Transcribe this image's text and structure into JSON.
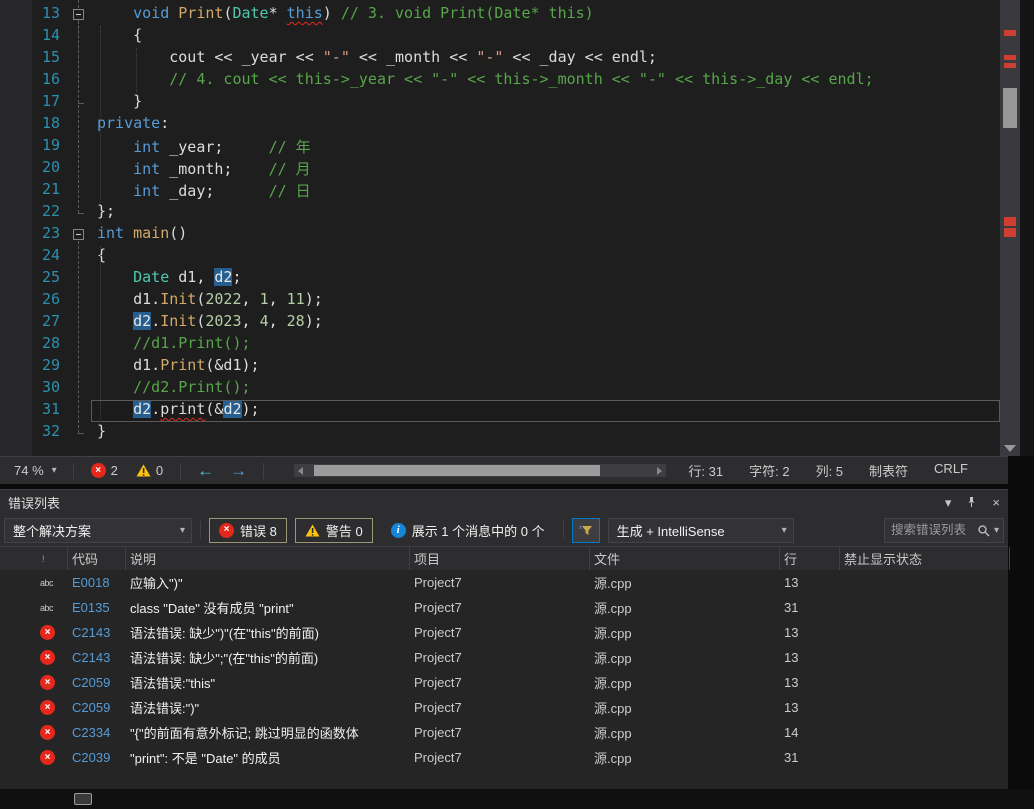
{
  "colors": {
    "accent": "#007ACC",
    "error_red": "#E5281C",
    "warning_yellow": "#FFC20E",
    "keyword": "#569CD6",
    "type": "#4EC9B0",
    "string": "#D69D85",
    "comment": "#57A64A",
    "number": "#B5CEA8",
    "function": "#D2A96A",
    "line_number": "#2B91AF",
    "reference_highlight": "#265F8F"
  },
  "editor": {
    "code_lines": [
      {
        "n": "13",
        "fold": true,
        "tok": [
          [
            "d",
            "    "
          ],
          [
            "kw",
            "void"
          ],
          [
            "d",
            " "
          ],
          [
            "fn",
            "Print"
          ],
          [
            "d",
            "("
          ],
          [
            "ty",
            "Date"
          ],
          [
            "d",
            "* "
          ],
          [
            "kw sq",
            "this"
          ],
          [
            "d",
            ") "
          ],
          [
            "cm",
            "// 3. void Print(Date* this)"
          ]
        ]
      },
      {
        "n": "14",
        "tok": [
          [
            "d",
            "    {"
          ]
        ]
      },
      {
        "n": "15",
        "tok": [
          [
            "d",
            "        cout << _year << "
          ],
          [
            "st",
            "\"-\""
          ],
          [
            "d",
            " << _month << "
          ],
          [
            "st",
            "\"-\""
          ],
          [
            "d",
            " << _day << endl;"
          ]
        ]
      },
      {
        "n": "16",
        "tok": [
          [
            "d",
            "        "
          ],
          [
            "cm",
            "// 4. cout << this->_year << \"-\" << this->_month << \"-\" << this->_day << endl;"
          ]
        ]
      },
      {
        "n": "17",
        "tok": [
          [
            "d",
            "    }"
          ]
        ]
      },
      {
        "n": "18",
        "tok": [
          [
            "kw",
            "private"
          ],
          [
            "d",
            ":"
          ]
        ]
      },
      {
        "n": "19",
        "tok": [
          [
            "d",
            "    "
          ],
          [
            "kw",
            "int"
          ],
          [
            "d",
            " _year;     "
          ],
          [
            "cm",
            "// 年"
          ]
        ]
      },
      {
        "n": "20",
        "tok": [
          [
            "d",
            "    "
          ],
          [
            "kw",
            "int"
          ],
          [
            "d",
            " _month;    "
          ],
          [
            "cm",
            "// 月"
          ]
        ]
      },
      {
        "n": "21",
        "tok": [
          [
            "d",
            "    "
          ],
          [
            "kw",
            "int"
          ],
          [
            "d",
            " _day;      "
          ],
          [
            "cm",
            "// 日"
          ]
        ]
      },
      {
        "n": "22",
        "tok": [
          [
            "d",
            "};"
          ]
        ]
      },
      {
        "n": "23",
        "fold": true,
        "tok": [
          [
            "kw",
            "int"
          ],
          [
            "d",
            " "
          ],
          [
            "fn",
            "main"
          ],
          [
            "d",
            "()"
          ]
        ]
      },
      {
        "n": "24",
        "tok": [
          [
            "d",
            "{"
          ]
        ]
      },
      {
        "n": "25",
        "tok": [
          [
            "d",
            "    "
          ],
          [
            "ty",
            "Date"
          ],
          [
            "d",
            " d1, "
          ],
          [
            "hl",
            "d2"
          ],
          [
            "d",
            ";"
          ]
        ]
      },
      {
        "n": "26",
        "tok": [
          [
            "d",
            "    d1."
          ],
          [
            "fn",
            "Init"
          ],
          [
            "d",
            "("
          ],
          [
            "nu",
            "2022"
          ],
          [
            "d",
            ", "
          ],
          [
            "nu",
            "1"
          ],
          [
            "d",
            ", "
          ],
          [
            "nu",
            "11"
          ],
          [
            "d",
            ");"
          ]
        ]
      },
      {
        "n": "27",
        "tok": [
          [
            "d",
            "    "
          ],
          [
            "hl",
            "d2"
          ],
          [
            "d",
            "."
          ],
          [
            "fn",
            "Init"
          ],
          [
            "d",
            "("
          ],
          [
            "nu",
            "2023"
          ],
          [
            "d",
            ", "
          ],
          [
            "nu",
            "4"
          ],
          [
            "d",
            ", "
          ],
          [
            "nu",
            "28"
          ],
          [
            "d",
            ");"
          ]
        ]
      },
      {
        "n": "28",
        "tok": [
          [
            "d",
            "    "
          ],
          [
            "cm",
            "//d1.Print();"
          ]
        ]
      },
      {
        "n": "29",
        "tok": [
          [
            "d",
            "    d1."
          ],
          [
            "fn",
            "Print"
          ],
          [
            "d",
            "(&d1);"
          ]
        ]
      },
      {
        "n": "30",
        "tok": [
          [
            "d",
            "    "
          ],
          [
            "cm",
            "//d2.Print();"
          ]
        ]
      },
      {
        "n": "31",
        "cur": true,
        "tok": [
          [
            "d",
            "    "
          ],
          [
            "hl",
            "d2"
          ],
          [
            "d",
            "."
          ],
          [
            "d sq",
            "print"
          ],
          [
            "d",
            "(&"
          ],
          [
            "hl",
            "d2"
          ],
          [
            "d",
            ");"
          ]
        ]
      },
      {
        "n": "32",
        "tok": [
          [
            "d",
            "}"
          ]
        ]
      }
    ]
  },
  "editor_status": {
    "zoom": "74 %",
    "errors": "2",
    "warnings": "0",
    "line_label": "行: 31",
    "char_label": "字符: 2",
    "col_label": "列: 5",
    "tabs_label": "制表符",
    "eol_label": "CRLF"
  },
  "error_list": {
    "title": "错误列表",
    "scope_dropdown": "整个解决方案",
    "errors_button": "错误 8",
    "warnings_button": "警告 0",
    "messages_button": "展示 1 个消息中的 0 个",
    "source_dropdown": "生成 + IntelliSense",
    "search_placeholder": "搜索错误列表",
    "columns": [
      "代码",
      "说明",
      "项目",
      "文件",
      "行",
      "禁止显示状态"
    ],
    "rows": [
      {
        "icon": "intellisense-error",
        "code": "E0018",
        "desc": "应输入\")\"",
        "project": "Project7",
        "file": "源.cpp",
        "line": "13",
        "suppression": ""
      },
      {
        "icon": "intellisense-error",
        "code": "E0135",
        "desc": "class \"Date\" 没有成员 \"print\"",
        "project": "Project7",
        "file": "源.cpp",
        "line": "31",
        "suppression": ""
      },
      {
        "icon": "error",
        "code": "C2143",
        "desc": "语法错误: 缺少\")\"(在\"this\"的前面)",
        "project": "Project7",
        "file": "源.cpp",
        "line": "13",
        "suppression": ""
      },
      {
        "icon": "error",
        "code": "C2143",
        "desc": "语法错误: 缺少\";\"(在\"this\"的前面)",
        "project": "Project7",
        "file": "源.cpp",
        "line": "13",
        "suppression": ""
      },
      {
        "icon": "error",
        "code": "C2059",
        "desc": "语法错误:\"this\"",
        "project": "Project7",
        "file": "源.cpp",
        "line": "13",
        "suppression": ""
      },
      {
        "icon": "error",
        "code": "C2059",
        "desc": "语法错误:\")\"",
        "project": "Project7",
        "file": "源.cpp",
        "line": "13",
        "suppression": ""
      },
      {
        "icon": "error",
        "code": "C2334",
        "desc": "\"{\"的前面有意外标记; 跳过明显的函数体",
        "project": "Project7",
        "file": "源.cpp",
        "line": "14",
        "suppression": ""
      },
      {
        "icon": "error",
        "code": "C2039",
        "desc": "\"print\": 不是 \"Date\" 的成员",
        "project": "Project7",
        "file": "源.cpp",
        "line": "31",
        "suppression": ""
      }
    ]
  }
}
